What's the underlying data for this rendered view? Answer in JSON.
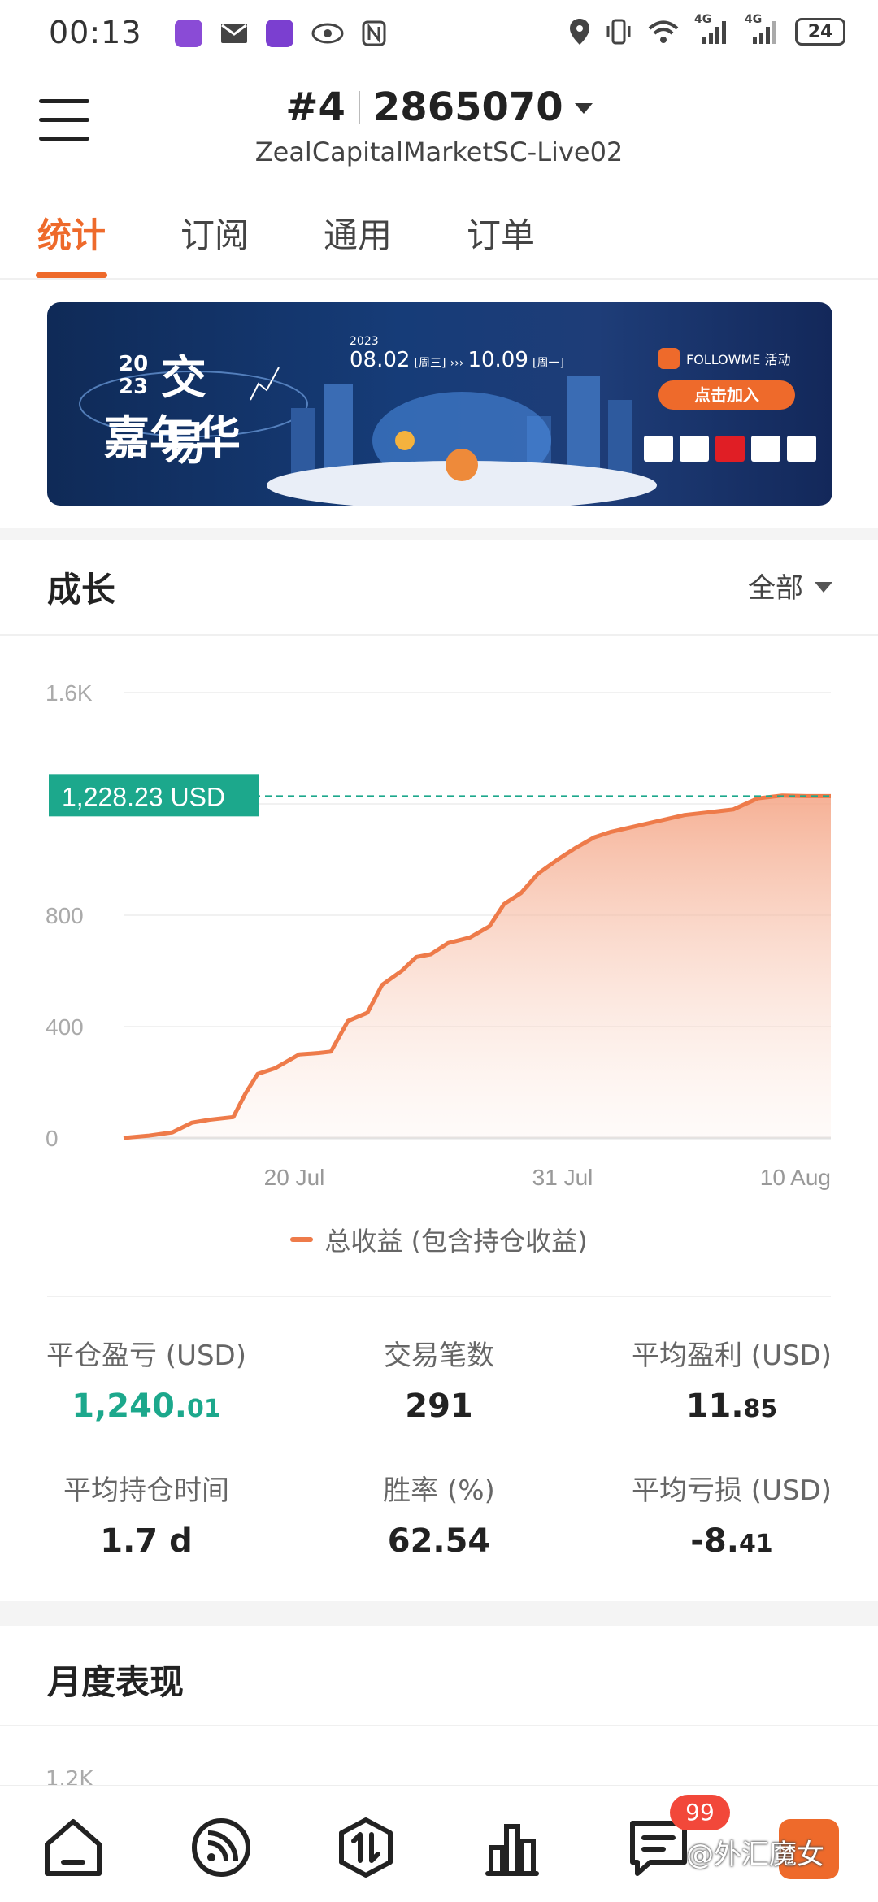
{
  "status_bar": {
    "time": "00:13",
    "battery": "24",
    "network_1": "4G",
    "network_2": "4G",
    "left_icons": [
      "infinity-app-icon",
      "mail-icon",
      "infinity-app-icon",
      "eye-icon",
      "nfc-icon"
    ],
    "right_icons": [
      "location-icon",
      "vibrate-icon",
      "wifi-icon",
      "signal-icon",
      "signal-icon",
      "battery-icon"
    ]
  },
  "header": {
    "account_index": "#4",
    "account_number": "2865070",
    "server": "ZealCapitalMarketSC-Live02"
  },
  "tabs": [
    {
      "label": "统计",
      "active": true
    },
    {
      "label": "订阅",
      "active": false
    },
    {
      "label": "通用",
      "active": false
    },
    {
      "label": "订单",
      "active": false
    }
  ],
  "banner": {
    "year_top": "20",
    "year_bottom": "23",
    "title_line1": "交易",
    "title_line2": "嘉年华",
    "date_year": "2023",
    "date_start": "08.02",
    "date_start_day": "[周三]",
    "date_end": "10.09",
    "date_end_day": "[周一]",
    "brand": "FOLLOWME 活动",
    "cta": "点击加入"
  },
  "growth": {
    "title": "成长",
    "filter": "全部",
    "current_value_label": "1,228.23 USD",
    "legend": "总收益 (包含持仓收益)"
  },
  "chart_data": {
    "type": "area",
    "title": "成长",
    "ylim": [
      0,
      1600
    ],
    "y_ticks": [
      0,
      400,
      800,
      1200,
      1600
    ],
    "y_tick_labels": [
      "0",
      "400",
      "800",
      "",
      "1.6K"
    ],
    "x_tick_labels": [
      "20 Jul",
      "31 Jul",
      "10 Aug"
    ],
    "x_tick_positions": [
      7,
      18,
      28
    ],
    "x_range": [
      0,
      29
    ],
    "series": [
      {
        "name": "总收益 (包含持仓收益)",
        "color": "#ee7b4a",
        "x": [
          0,
          1,
          2,
          2.8,
          3.5,
          4.5,
          5,
          5.5,
          6.2,
          7.2,
          8,
          8.5,
          9.2,
          10,
          10.6,
          11.4,
          12,
          12.6,
          13.3,
          14.2,
          15,
          15.6,
          16.3,
          17,
          17.8,
          18.5,
          19.3,
          20,
          21,
          22,
          23,
          24,
          25,
          26,
          27,
          28,
          29
        ],
        "values": [
          0,
          8,
          20,
          55,
          65,
          75,
          160,
          230,
          250,
          300,
          305,
          310,
          420,
          450,
          550,
          600,
          650,
          660,
          700,
          720,
          760,
          840,
          880,
          950,
          1000,
          1040,
          1080,
          1100,
          1120,
          1140,
          1160,
          1170,
          1180,
          1220,
          1230,
          1228,
          1228
        ]
      }
    ],
    "reference_line": {
      "value": 1228.23,
      "label": "1,228.23 USD",
      "color": "#1ca88c"
    },
    "grid": true
  },
  "stats": [
    {
      "label": "平仓盈亏 (USD)",
      "value_main": "1,240.",
      "value_small": "01",
      "color": "green"
    },
    {
      "label": "交易笔数",
      "value_main": "291",
      "value_small": "",
      "color": "normal"
    },
    {
      "label": "平均盈利 (USD)",
      "value_main": "11.",
      "value_small": "85",
      "color": "normal"
    },
    {
      "label": "平均持仓时间",
      "value_main": "1.7 d",
      "value_small": "",
      "color": "normal"
    },
    {
      "label": "胜率 (%)",
      "value_main": "62.54",
      "value_small": "",
      "color": "normal"
    },
    {
      "label": "平均亏损 (USD)",
      "value_main": "-8.",
      "value_small": "41",
      "color": "normal"
    }
  ],
  "monthly": {
    "title": "月度表现",
    "first_tick": "1.2K"
  },
  "bottom_nav": {
    "items": [
      "home-icon",
      "feed-icon",
      "trade-icon",
      "chart-icon",
      "messages-icon"
    ],
    "badge": "99",
    "watermark": "@外汇魔女"
  },
  "colors": {
    "accent": "#ee6a2b",
    "profit": "#1ca88c",
    "badge": "#f2483a"
  }
}
